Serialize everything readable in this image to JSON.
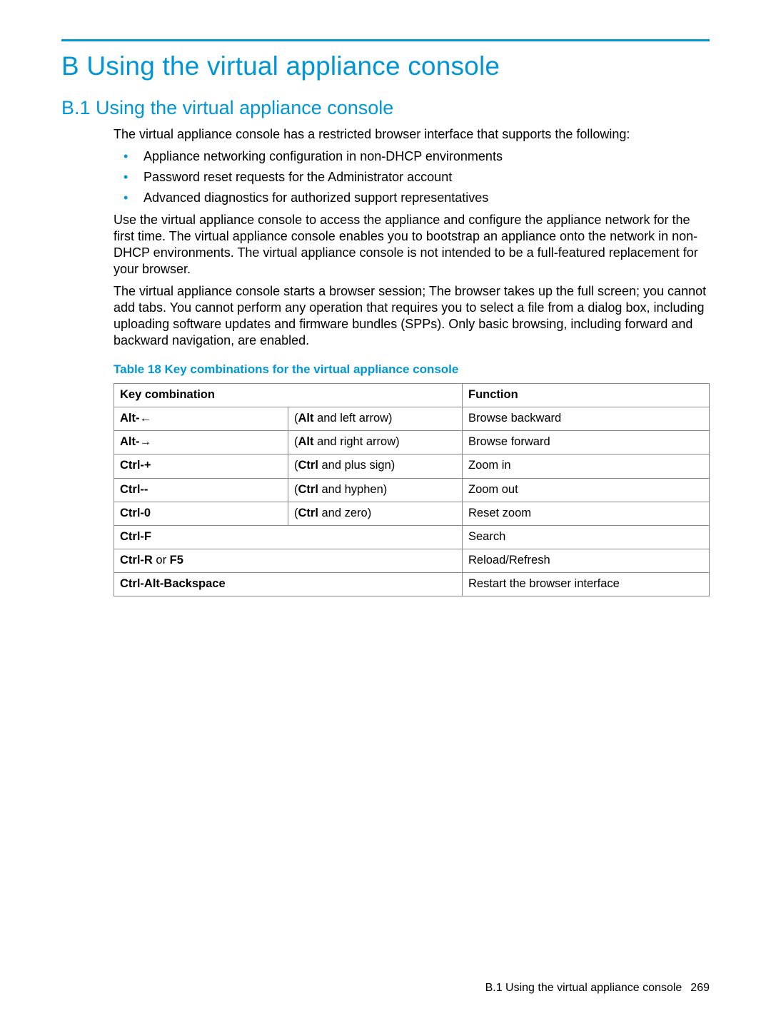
{
  "appendix": {
    "label": "B",
    "title": "Using the virtual appliance console"
  },
  "section": {
    "label": "B.1",
    "title": "Using the virtual appliance console"
  },
  "intro_p1": "The virtual appliance console has a restricted browser interface that supports the following:",
  "bullets": [
    "Appliance networking configuration in non-DHCP environments",
    "Password reset requests for the Administrator account",
    "Advanced diagnostics for authorized support representatives"
  ],
  "para2": "Use the virtual appliance console to access the appliance and configure the appliance network for the first time. The virtual appliance console enables you to bootstrap an appliance onto the network in non-DHCP environments. The virtual appliance console is not intended to be a full-featured replacement for your browser.",
  "para3": "The virtual appliance console starts a browser session; The browser takes up the full screen; you cannot add tabs. You cannot perform any operation that requires you to select a file from a dialog box, including uploading software updates and firmware bundles (SPPs). Only basic browsing, including forward and backward navigation, are enabled.",
  "table": {
    "caption": "Table 18 Key combinations for the virtual appliance console",
    "head": {
      "c1": "Key combination",
      "c2": "Function"
    },
    "rows": [
      {
        "key_bold": "Alt-",
        "key_tail": "←",
        "desc_prefix": "(",
        "desc_bold": "Alt",
        "desc_suffix": " and left arrow)",
        "func": "Browse backward"
      },
      {
        "key_bold": "Alt-",
        "key_tail": "→",
        "desc_prefix": "(",
        "desc_bold": "Alt",
        "desc_suffix": " and right arrow)",
        "func": "Browse forward"
      },
      {
        "key_bold": "Ctrl-+",
        "key_tail": "",
        "desc_prefix": "(",
        "desc_bold": "Ctrl",
        "desc_suffix": " and plus sign)",
        "func": "Zoom in"
      },
      {
        "key_bold": "Ctrl--",
        "key_tail": "",
        "desc_prefix": "(",
        "desc_bold": "Ctrl",
        "desc_suffix": " and hyphen)",
        "func": "Zoom out"
      },
      {
        "key_bold": "Ctrl-0",
        "key_tail": "",
        "desc_prefix": "(",
        "desc_bold": "Ctrl",
        "desc_suffix": " and zero)",
        "func": "Reset zoom"
      },
      {
        "key_bold": "Ctrl-F",
        "key_tail": "",
        "desc_prefix": "",
        "desc_bold": "",
        "desc_suffix": "",
        "func": "Search"
      },
      {
        "key_bold": "Ctrl-R",
        "key_mid": " or ",
        "key_bold2": "F5",
        "desc_prefix": "",
        "desc_bold": "",
        "desc_suffix": "",
        "func": "Reload/Refresh"
      },
      {
        "key_bold": "Ctrl-Alt-Backspace",
        "key_tail": "",
        "desc_prefix": "",
        "desc_bold": "",
        "desc_suffix": "",
        "func": "Restart the browser interface"
      }
    ]
  },
  "footer": {
    "section": "B.1 Using the virtual appliance console",
    "page": "269"
  }
}
